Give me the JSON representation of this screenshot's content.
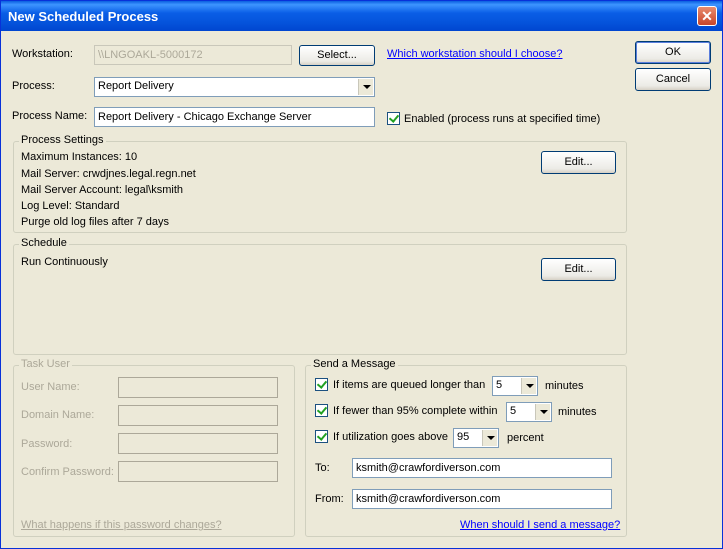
{
  "window": {
    "title": "New Scheduled Process",
    "close_glyph": "✕"
  },
  "buttons": {
    "ok": "OK",
    "cancel": "Cancel",
    "select": "Select...",
    "edit_settings": "Edit...",
    "edit_schedule": "Edit..."
  },
  "workstation": {
    "label": "Workstation:",
    "value": "\\\\LNGOAKL-5000172",
    "help_link": "Which workstation should I choose?"
  },
  "process": {
    "label": "Process:",
    "value": "Report Delivery"
  },
  "process_name": {
    "label": "Process Name:",
    "value": "Report Delivery - Chicago Exchange Server",
    "enabled_label": "Enabled (process runs at specified time)",
    "enabled_checked": true
  },
  "process_settings": {
    "legend": "Process Settings",
    "lines": [
      "Maximum Instances: 10",
      "Mail Server: crwdjnes.legal.regn.net",
      "Mail Server Account: legal\\ksmith",
      "Log Level: Standard",
      "Purge old log files after 7 days"
    ]
  },
  "schedule": {
    "legend": "Schedule",
    "value": "Run Continuously"
  },
  "task_user": {
    "legend": "Task User",
    "user_name_label": "User Name:",
    "domain_name_label": "Domain Name:",
    "password_label": "Password:",
    "confirm_password_label": "Confirm Password:",
    "help_link": "What happens if this password changes?"
  },
  "send_message": {
    "legend": "Send a Message",
    "queued_label": "If items are queued longer than",
    "queued_value": "5",
    "queued_unit": "minutes",
    "queued_checked": true,
    "fewer_label": "If fewer than 95% complete within",
    "fewer_value": "5",
    "fewer_unit": "minutes",
    "fewer_checked": true,
    "util_label": "If utilization goes above",
    "util_value": "95",
    "util_unit": "percent",
    "util_checked": true,
    "to_label": "To:",
    "to_value": "ksmith@crawfordiverson.com",
    "from_label": "From:",
    "from_value": "ksmith@crawfordiverson.com",
    "help_link": "When should I send a message?"
  }
}
